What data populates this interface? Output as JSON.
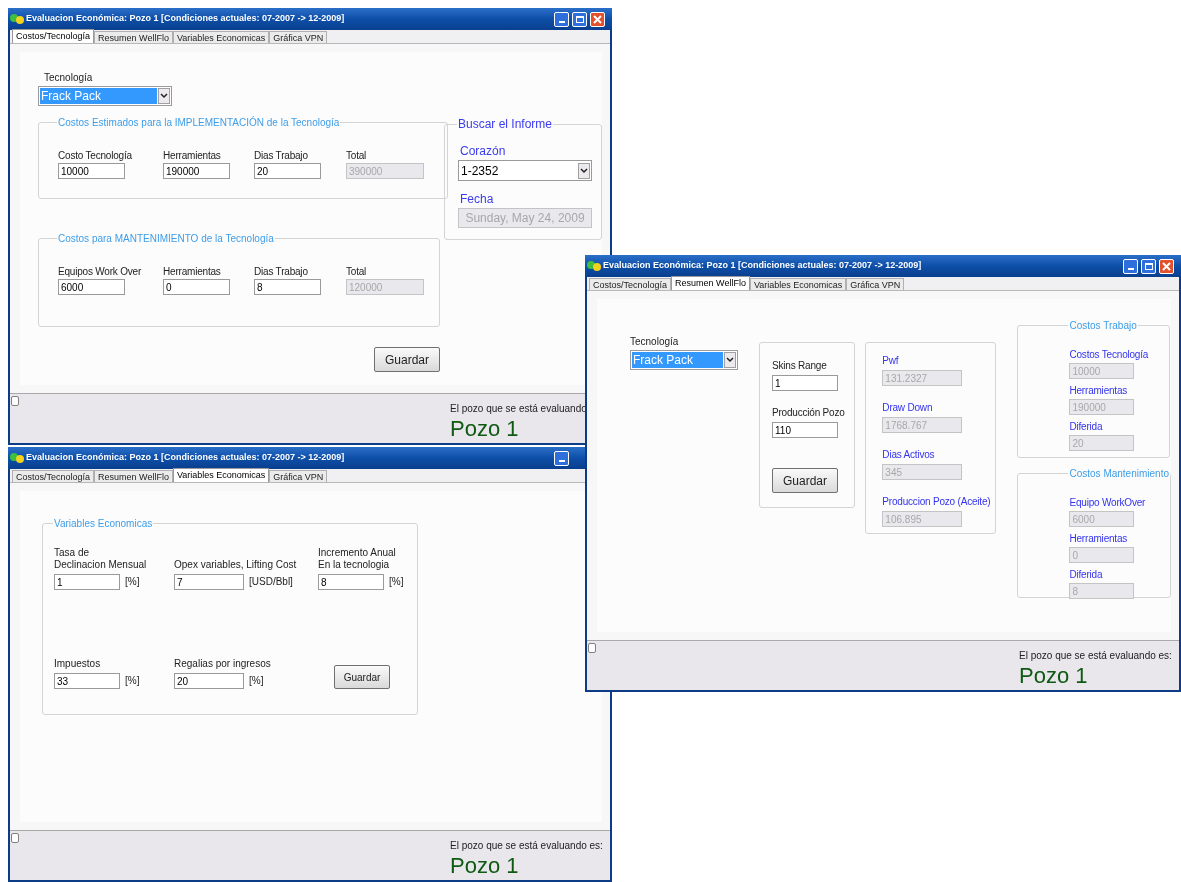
{
  "windows": [
    {
      "kind": "costos",
      "title": "Evaluacion Económica: Pozo 1 [Condiciones actuales: 07-2007 -> 12-2009]",
      "controls": {
        "minimize": true,
        "maximize": true,
        "close": true
      },
      "tabs": [
        {
          "label": "Costos/Tecnología",
          "selected": true
        },
        {
          "label": "Resumen WellFlo",
          "selected": false
        },
        {
          "label": "Variables Economicas",
          "selected": false
        },
        {
          "label": "Gráfica VPN",
          "selected": false
        }
      ],
      "technology": {
        "label": "Tecnología",
        "value": "Frack Pack",
        "focused": true
      },
      "groups": [
        {
          "title": "Costos Estimados para la IMPLEMENTACIÓN de la Tecnología",
          "fields": [
            {
              "label": "Costo Tecnología",
              "value": "10000",
              "disabled": false
            },
            {
              "label": "Herramientas",
              "value": "190000",
              "disabled": false
            },
            {
              "label": "Dias Trabajo",
              "value": "20",
              "disabled": false
            },
            {
              "label": "Total",
              "value": "390000",
              "disabled": true
            }
          ]
        },
        {
          "title": "Costos para MANTENIMIENTO de la Tecnología",
          "fields": [
            {
              "label": "Equipos Work Over",
              "value": "6000",
              "disabled": false
            },
            {
              "label": "Herramientas",
              "value": "0",
              "disabled": false
            },
            {
              "label": "Dias Trabajo",
              "value": "8",
              "disabled": false
            },
            {
              "label": "Total",
              "value": "120000",
              "disabled": true
            }
          ]
        }
      ],
      "search": {
        "title": "Buscar el Informe",
        "core": {
          "label": "Corazón",
          "value": "1-2352",
          "focused": false
        },
        "date": {
          "label": "Fecha",
          "value": "Sunday, May 24, 2009",
          "disabled": true
        }
      },
      "save_button": "Guardar",
      "status": {
        "checked": false,
        "label": "El pozo que se está evaluando",
        "well": "Pozo 1"
      }
    },
    {
      "kind": "resumen",
      "title": "Evaluacion Económica: Pozo 1 [Condiciones actuales: 07-2007 -> 12-2009]",
      "controls": {
        "minimize": true,
        "maximize": true,
        "close": true
      },
      "tabs": [
        {
          "label": "Costos/Tecnología",
          "selected": false
        },
        {
          "label": "Resumen WellFlo",
          "selected": true
        },
        {
          "label": "Variables Economicas",
          "selected": false
        },
        {
          "label": "Gráfica VPN",
          "selected": false
        }
      ],
      "technology": {
        "label": "Tecnología",
        "value": "Frack Pack",
        "focused": true
      },
      "inputs": {
        "fields": [
          {
            "label": "Skins Range",
            "value": "1",
            "disabled": false
          },
          {
            "label": "Producción Pozo",
            "value": "110",
            "disabled": false
          }
        ],
        "save_button": "Guardar"
      },
      "results": {
        "fields": [
          {
            "label": "Pwf",
            "value": "131.2327",
            "disabled": true
          },
          {
            "label": "Draw Down",
            "value": "1768.767",
            "disabled": true
          },
          {
            "label": "Dias Activos",
            "value": "345",
            "disabled": true
          },
          {
            "label": "Produccion Pozo (Aceite)",
            "value": "106.895",
            "disabled": true
          }
        ]
      },
      "groups": [
        {
          "title": "Costos Trabajo",
          "fields": [
            {
              "label": "Costos Tecnología",
              "value": "10000",
              "disabled": true
            },
            {
              "label": "Herramientas",
              "value": "190000",
              "disabled": true
            },
            {
              "label": "Diferida",
              "value": "20",
              "disabled": true
            }
          ]
        },
        {
          "title": "Costos Mantenimiento",
          "fields": [
            {
              "label": "Equipo WorkOver",
              "value": "6000",
              "disabled": true
            },
            {
              "label": "Herramientas",
              "value": "0",
              "disabled": true
            },
            {
              "label": "Diferida",
              "value": "8",
              "disabled": true
            }
          ]
        }
      ],
      "status": {
        "checked": false,
        "label": "El pozo que se está evaluando es:",
        "well": "Pozo 1"
      }
    },
    {
      "kind": "variables",
      "title": "Evaluacion Económica: Pozo 1 [Condiciones actuales: 07-2007 -> 12-2009]",
      "controls": {
        "minimize": true
      },
      "tabs": [
        {
          "label": "Costos/Tecnología",
          "selected": false
        },
        {
          "label": "Resumen WellFlo",
          "selected": false
        },
        {
          "label": "Variables Economicas",
          "selected": true
        },
        {
          "label": "Gráfica VPN",
          "selected": false
        }
      ],
      "groups": [
        {
          "title": "Variables Economicas",
          "fields": [
            {
              "label": "Tasa de\nDeclinacion Mensual",
              "value": "1",
              "unit": "[%]",
              "disabled": false
            },
            {
              "label": "Opex variables, Lifting Cost",
              "value": "7",
              "unit": "[USD/Bbl]",
              "disabled": false
            },
            {
              "label": "Incremento Anual\nEn la tecnologia",
              "value": "8",
              "unit": "[%]",
              "disabled": false
            },
            {
              "label": "Impuestos",
              "value": "33",
              "unit": "[%]",
              "disabled": false
            },
            {
              "label": "Regalias por ingresos",
              "value": "20",
              "unit": "[%]",
              "disabled": false
            }
          ]
        }
      ],
      "save_button": "Guardar",
      "status": {
        "checked": false,
        "label": "El pozo que se está evaluando es:",
        "well": "Pozo 1"
      }
    }
  ]
}
